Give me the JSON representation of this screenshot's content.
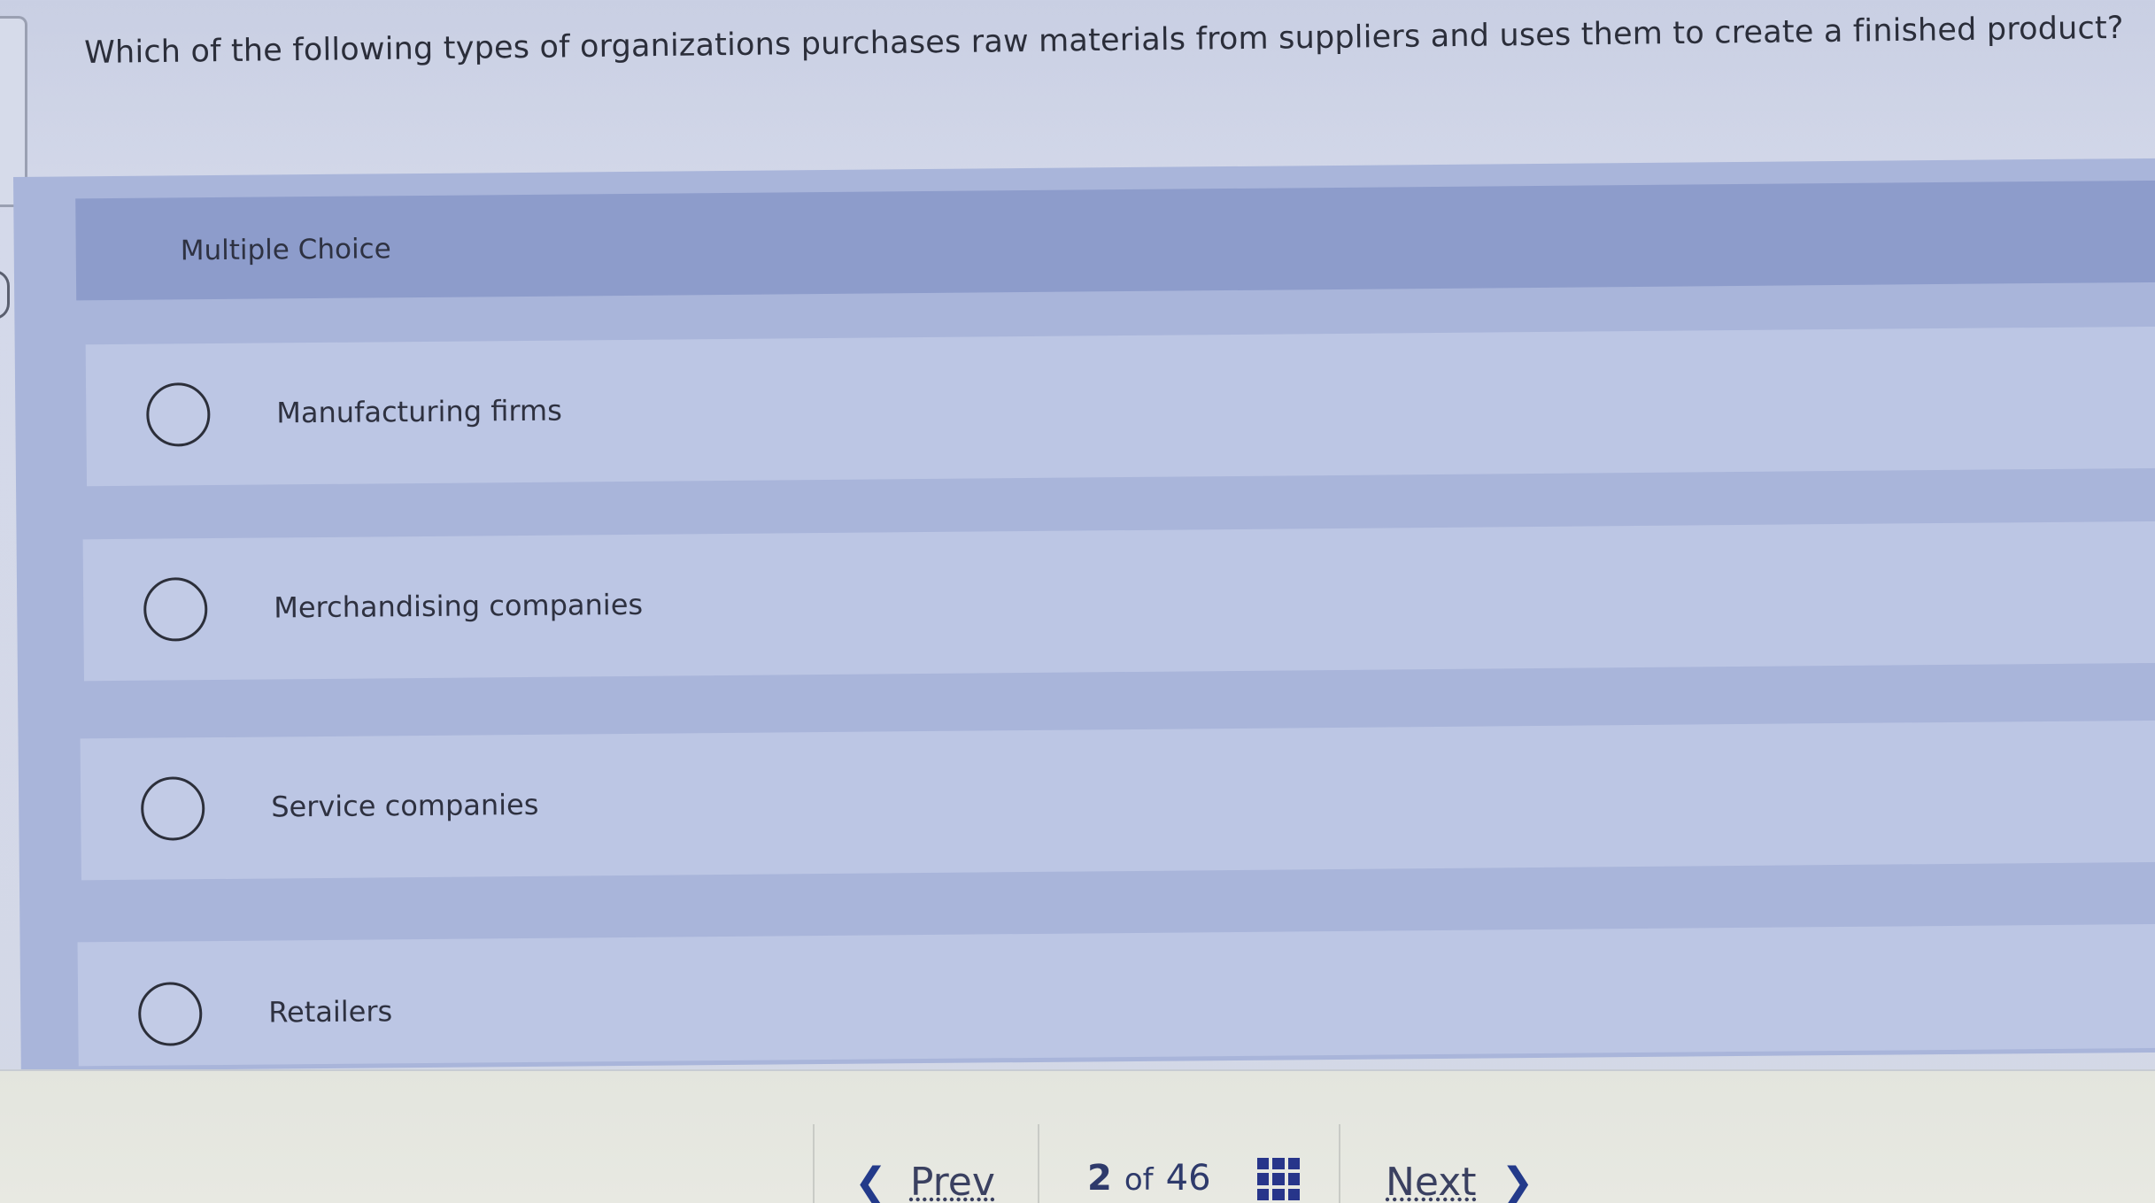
{
  "question": {
    "text": "Which of the following types of organizations purchases raw materials from suppliers and uses them to create a finished product?"
  },
  "panel": {
    "header_label": "Multiple Choice",
    "options": [
      {
        "label": "Manufacturing firms",
        "selected": false
      },
      {
        "label": "Merchandising companies",
        "selected": false
      },
      {
        "label": "Service companies",
        "selected": false
      },
      {
        "label": "Retailers",
        "selected": false
      }
    ]
  },
  "footer": {
    "prev_label": "Prev",
    "current_page": "2",
    "of_label": "of",
    "total_pages": "46",
    "next_label": "Next",
    "prev_icon": "chevron-left-icon",
    "next_icon": "chevron-right-icon",
    "grid_icon": "question-grid-icon",
    "accent_color": "#233a8a"
  }
}
